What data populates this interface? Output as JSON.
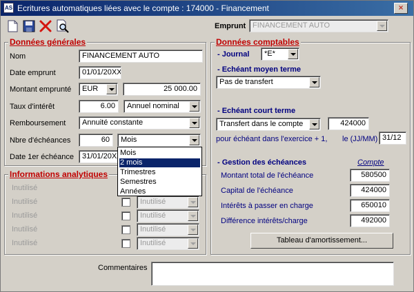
{
  "window": {
    "title": "Ecritures automatiques liées avec le compte : 174000 - Financement",
    "app_icon": "AS",
    "close_glyph": "×"
  },
  "toolbar": {
    "icons": [
      "new-document-icon",
      "save-icon",
      "delete-icon",
      "preview-icon"
    ]
  },
  "emprunt": {
    "label": "Emprunt",
    "value": "FINANCEMENT AUTO"
  },
  "donnees_generales": {
    "title": "Données générales",
    "nom": {
      "label": "Nom",
      "value": "FINANCEMENT AUTO"
    },
    "date_emprunt": {
      "label": "Date emprunt",
      "value": "01/01/20XX"
    },
    "montant": {
      "label": "Montant emprunté",
      "currency": "EUR",
      "value": "25 000.00"
    },
    "taux": {
      "label": "Taux d'intérêt",
      "value": "6.00",
      "mode": "Annuel nominal"
    },
    "remboursement": {
      "label": "Remboursement",
      "value": "Annuité constante"
    },
    "nbre_echeances": {
      "label": "Nbre d'échéances",
      "value": "60",
      "period": "Mois"
    },
    "date_1er": {
      "label": "Date 1er échéance",
      "value": "31/01/20XX"
    }
  },
  "period_dropdown": {
    "options": [
      "Mois",
      "2 mois",
      "Trimestres",
      "Semestres",
      "Années"
    ],
    "selected": "2 mois"
  },
  "informations_analytiques": {
    "title": "Informations analytiques",
    "rows": [
      {
        "label": "Inutilisé",
        "value": "Inutilisé"
      },
      {
        "label": "Inutilisé",
        "value": "Inutilisé"
      },
      {
        "label": "Inutilisé",
        "value": "Inutilisé"
      },
      {
        "label": "Inutilisé",
        "value": "Inutilisé"
      },
      {
        "label": "Inutilisé",
        "value": "Inutilisé"
      }
    ]
  },
  "donnees_comptables": {
    "title": "Données comptables",
    "journal": {
      "label": "- Journal",
      "value": "*E*"
    },
    "moyen_terme": {
      "label": "- Echéant moyen terme",
      "value": "Pas de transfert"
    },
    "court_terme": {
      "label": "- Echéant court terme",
      "value": "Transfert dans le compte",
      "account": "424000"
    },
    "echeant_exercice": {
      "label": "pour échéant dans l'exercice + 1,",
      "date_label": "le (JJ/MM)",
      "date_value": "31/12"
    },
    "gestion": {
      "label": "- Gestion des échéances",
      "column_header": "Compte",
      "rows": [
        {
          "label": "Montant total de l'échéance",
          "value": "580500"
        },
        {
          "label": "Capital de l'échéance",
          "value": "424000"
        },
        {
          "label": "Intérêts à passer en charge",
          "value": "650010"
        },
        {
          "label": "Différence intérêts/charge",
          "value": "492000"
        }
      ]
    },
    "tableau_button": "Tableau d'amortissement..."
  },
  "commentaires": {
    "label": "Commentaires",
    "value": ""
  },
  "colors": {
    "title_bar": "#0a246a",
    "section_title": "#c00000",
    "window_bg": "#d4d0c8",
    "selection": "#0a246a"
  }
}
